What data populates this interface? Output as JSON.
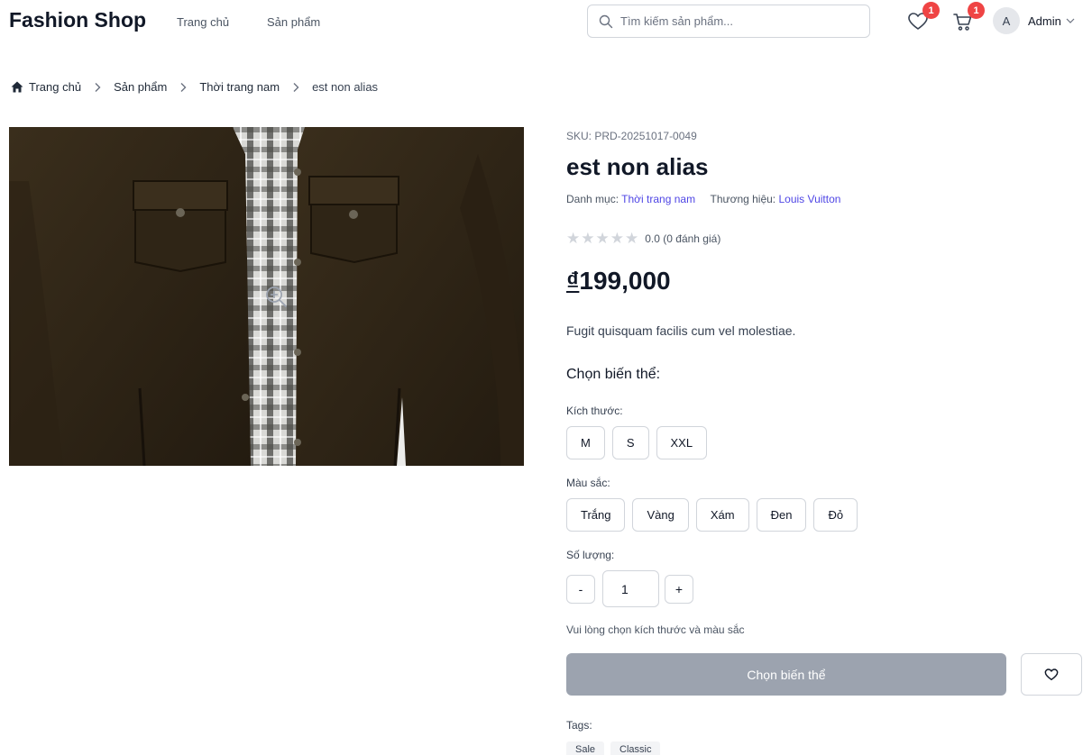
{
  "header": {
    "brand": "Fashion Shop",
    "nav": [
      {
        "label": "Trang chủ"
      },
      {
        "label": "Sản phẩm"
      }
    ],
    "search_placeholder": "Tìm kiếm sản phẩm...",
    "wishlist_count": "1",
    "cart_count": "1",
    "avatar_letter": "A",
    "user_name": "Admin"
  },
  "breadcrumb": [
    "Trang chủ",
    "Sản phẩm",
    "Thời trang nam",
    "est non alias"
  ],
  "product": {
    "sku": "SKU: PRD-20251017-0049",
    "name": "est non alias",
    "category_label": "Danh mục:",
    "category": "Thời trang nam",
    "brand_label": "Thương hiệu:",
    "brand": "Louis Vuitton",
    "rating_value": 0,
    "rating_max": 5,
    "rating_text": "0.0 (0 đánh giá)",
    "currency": "₫",
    "price": "199,000",
    "description": "Fugit quisquam facilis cum vel molestiae."
  },
  "variants": {
    "title": "Chọn biến thể:",
    "size_label": "Kích thước:",
    "sizes": [
      "M",
      "S",
      "XXL"
    ],
    "color_label": "Màu sắc:",
    "colors": [
      "Trắng",
      "Vàng",
      "Xám",
      "Đen",
      "Đỏ"
    ],
    "qty_label": "Số lượng:",
    "minus": "-",
    "plus": "+",
    "quantity": "1",
    "hint": "Vui lòng chọn kích thước và màu sắc",
    "cta_label": "Chọn biến thể"
  },
  "tags": {
    "label": "Tags:",
    "items": [
      "Sale",
      "Classic"
    ]
  },
  "colors": {
    "accent_link": "#4f46e5",
    "badge": "#ef4444",
    "cta_disabled": "#9ca3af"
  }
}
